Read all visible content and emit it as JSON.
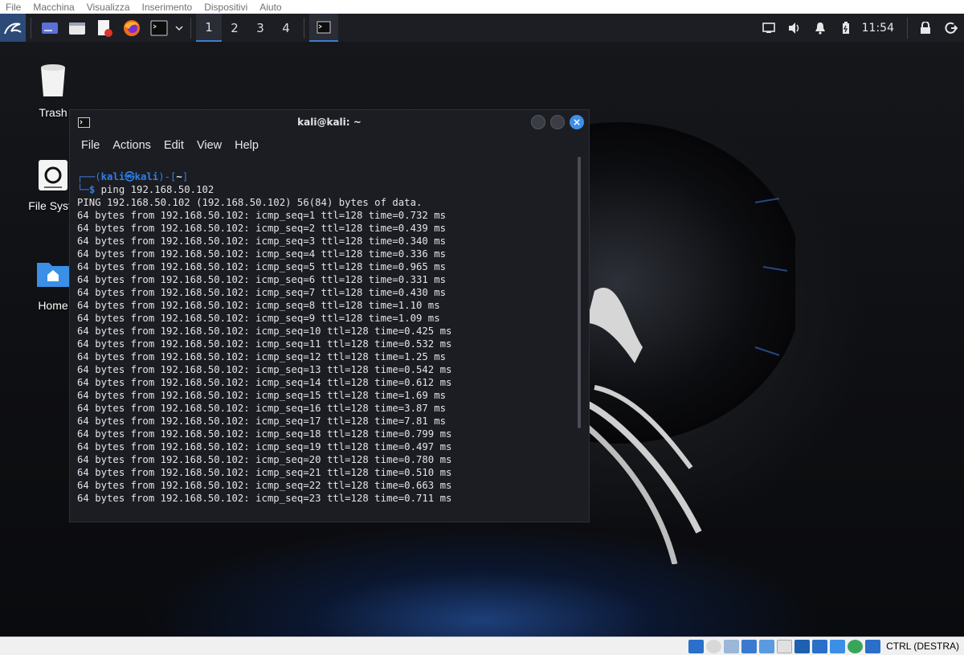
{
  "vbox_menu": [
    "File",
    "Macchina",
    "Visualizza",
    "Inserimento",
    "Dispositivi",
    "Aiuto"
  ],
  "panel": {
    "launchers": [
      "kali-menu-icon",
      "desktop-icon",
      "file-manager-icon",
      "text-editor-icon",
      "firefox-icon",
      "terminal-icon"
    ],
    "workspaces": [
      "1",
      "2",
      "3",
      "4"
    ],
    "active_workspace": "1",
    "clock": "11:54"
  },
  "desktop": {
    "icons": [
      {
        "label": "Trash"
      },
      {
        "label": "File Syste"
      },
      {
        "label": "Home"
      }
    ]
  },
  "terminal": {
    "title": "kali@kali: ~",
    "menu": [
      "File",
      "Actions",
      "Edit",
      "View",
      "Help"
    ],
    "prompt_user": "kali",
    "prompt_at": "㉿",
    "prompt_host": "kali",
    "prompt_dir": "~",
    "command": "ping 192.168.50.102",
    "output": [
      "PING 192.168.50.102 (192.168.50.102) 56(84) bytes of data.",
      "64 bytes from 192.168.50.102: icmp_seq=1 ttl=128 time=0.732 ms",
      "64 bytes from 192.168.50.102: icmp_seq=2 ttl=128 time=0.439 ms",
      "64 bytes from 192.168.50.102: icmp_seq=3 ttl=128 time=0.340 ms",
      "64 bytes from 192.168.50.102: icmp_seq=4 ttl=128 time=0.336 ms",
      "64 bytes from 192.168.50.102: icmp_seq=5 ttl=128 time=0.965 ms",
      "64 bytes from 192.168.50.102: icmp_seq=6 ttl=128 time=0.331 ms",
      "64 bytes from 192.168.50.102: icmp_seq=7 ttl=128 time=0.430 ms",
      "64 bytes from 192.168.50.102: icmp_seq=8 ttl=128 time=1.10 ms",
      "64 bytes from 192.168.50.102: icmp_seq=9 ttl=128 time=1.09 ms",
      "64 bytes from 192.168.50.102: icmp_seq=10 ttl=128 time=0.425 ms",
      "64 bytes from 192.168.50.102: icmp_seq=11 ttl=128 time=0.532 ms",
      "64 bytes from 192.168.50.102: icmp_seq=12 ttl=128 time=1.25 ms",
      "64 bytes from 192.168.50.102: icmp_seq=13 ttl=128 time=0.542 ms",
      "64 bytes from 192.168.50.102: icmp_seq=14 ttl=128 time=0.612 ms",
      "64 bytes from 192.168.50.102: icmp_seq=15 ttl=128 time=1.69 ms",
      "64 bytes from 192.168.50.102: icmp_seq=16 ttl=128 time=3.87 ms",
      "64 bytes from 192.168.50.102: icmp_seq=17 ttl=128 time=7.81 ms",
      "64 bytes from 192.168.50.102: icmp_seq=18 ttl=128 time=0.799 ms",
      "64 bytes from 192.168.50.102: icmp_seq=19 ttl=128 time=0.497 ms",
      "64 bytes from 192.168.50.102: icmp_seq=20 ttl=128 time=0.780 ms",
      "64 bytes from 192.168.50.102: icmp_seq=21 ttl=128 time=0.510 ms",
      "64 bytes from 192.168.50.102: icmp_seq=22 ttl=128 time=0.663 ms",
      "64 bytes from 192.168.50.102: icmp_seq=23 ttl=128 time=0.711 ms"
    ]
  },
  "vbox_status": {
    "host_key": "CTRL (DESTRA)"
  },
  "colors": {
    "accent": "#3e7bd6",
    "panel_bg": "#1c1e24",
    "terminal_bg": "#1b1d23"
  }
}
